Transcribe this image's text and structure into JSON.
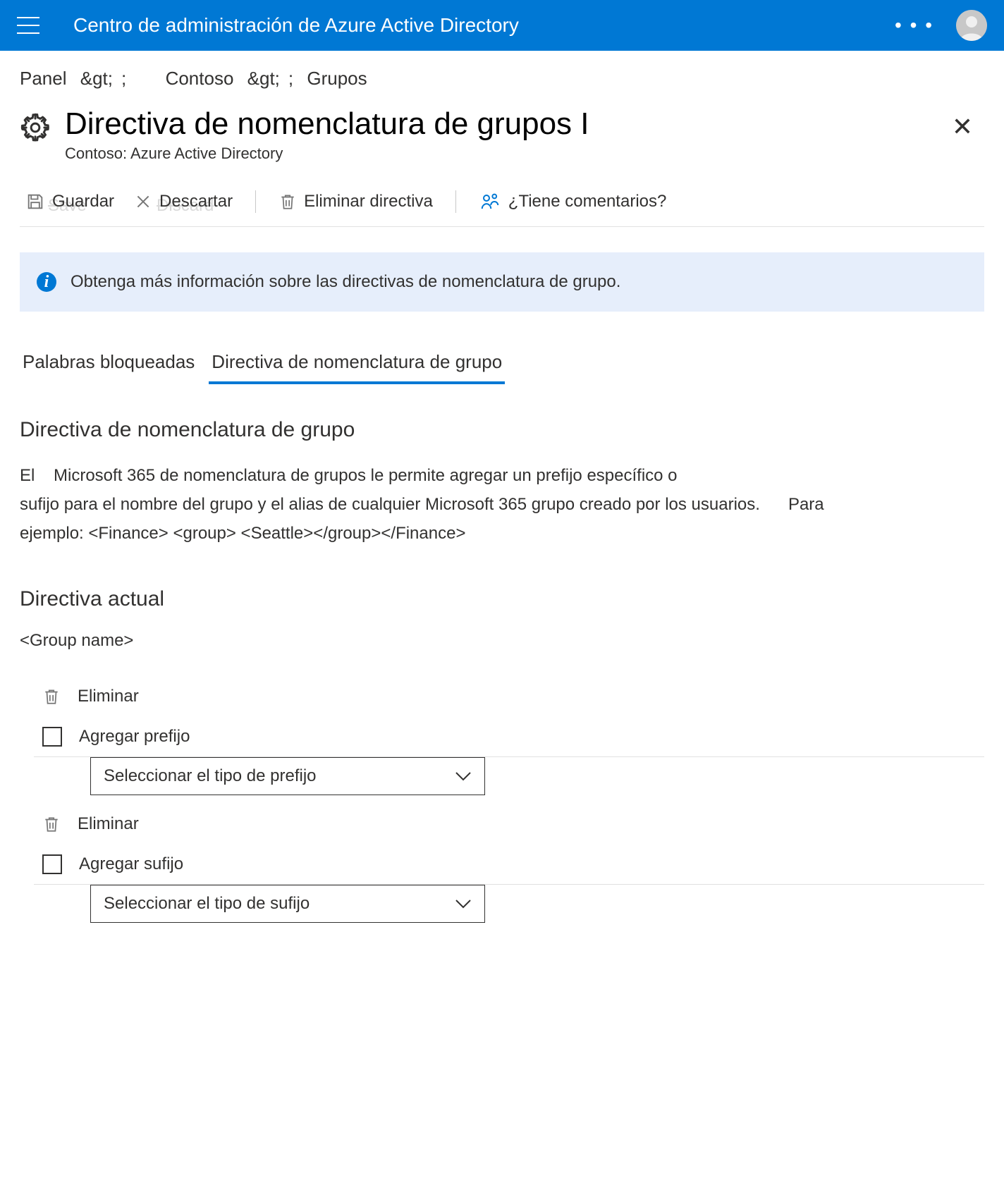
{
  "header": {
    "app_title": "Centro de administración de Azure Active Directory"
  },
  "breadcrumb": {
    "panel": "Panel",
    "sep": "&gt;",
    "org": "Contoso",
    "groups": "Grupos"
  },
  "page": {
    "title": "Directiva de nomenclatura de grupos I",
    "subtitle": "Contoso: Azure Active Directory"
  },
  "toolbar": {
    "save": "Guardar",
    "save_ghost": "Save",
    "discard": "Descartar",
    "discard_ghost": "Discard",
    "delete": "Eliminar directiva",
    "feedback": "¿Tiene comentarios?"
  },
  "info": {
    "text": "Obtenga más información sobre las directivas de nomenclatura de grupo."
  },
  "tabs": {
    "blocked": "Palabras bloqueadas",
    "naming": "Directiva de nomenclatura de grupo"
  },
  "section": {
    "heading": "Directiva de nomenclatura de grupo",
    "desc_line1_a": "El",
    "desc_line1_b": "Microsoft 365 de nomenclatura de grupos le permite agregar un prefijo específico o",
    "desc_line2": "sufijo para el nombre del grupo y el alias de cualquier Microsoft 365 grupo creado por los usuarios.",
    "desc_line2_b": "Para",
    "desc_line3": "ejemplo: <Finance> <group> <Seattle></group></Finance>"
  },
  "current": {
    "heading": "Directiva actual",
    "group_name": "<Group name>",
    "remove": "Eliminar",
    "add_prefix": "Agregar prefijo",
    "prefix_dropdown": "Seleccionar el tipo de prefijo",
    "add_suffix": "Agregar sufijo",
    "suffix_dropdown": "Seleccionar el tipo de sufijo"
  }
}
